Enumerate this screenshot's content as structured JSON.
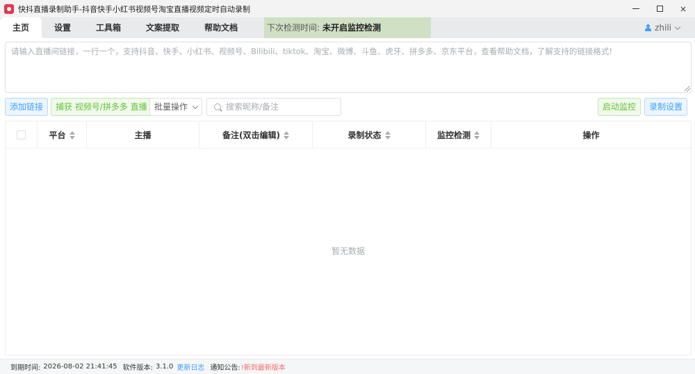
{
  "window": {
    "title": "快抖直播录制助手-抖音快手小红书视频号淘宝直播视频定时自动录制",
    "controls": {
      "minimize": "minimize-icon",
      "maximize": "maximize-icon",
      "close": "×"
    }
  },
  "tabs": [
    {
      "label": "主页",
      "active": true
    },
    {
      "label": "设置",
      "active": false
    },
    {
      "label": "工具箱",
      "active": false
    },
    {
      "label": "文案提取",
      "active": false
    },
    {
      "label": "帮助文档",
      "active": false
    }
  ],
  "monitor": {
    "label": "下次检测时间:",
    "value": "未开启监控检测"
  },
  "user": {
    "name": "zhili",
    "icon": "user-icon"
  },
  "link_input": {
    "placeholder": "请输入直播间链接，一行一个，支持抖音、快手、小红书、视频号、Bilibili、tiktok、淘宝、微博、斗鱼、虎牙、拼多多、京东平台，查看帮助文档，了解支持的链接格式!",
    "value": ""
  },
  "toolbar": {
    "add_link": "添加链接",
    "capture": "捕获 视频号/拼多多 直播",
    "batch": "批量操作",
    "search_placeholder": "搜索昵称/备注",
    "start_monitor": "启动监控",
    "record_settings": "录制设置"
  },
  "table": {
    "columns": [
      "平台",
      "主播",
      "备注(双击编辑)",
      "录制状态",
      "监控检测",
      "操作"
    ],
    "rows": [],
    "empty": "暂无数据"
  },
  "status": {
    "expire_label": "到期时间:",
    "expire_value": "2026-08-02 21:41:45",
    "version_label": "软件版本:",
    "version_value": "3.1.0",
    "changelog": "更新日志",
    "notice_label": "通知公告:",
    "notice_value": "!新到最新版本"
  },
  "colors": {
    "accent": "#409eff",
    "success": "#67c23a",
    "danger": "#f56c6c",
    "monitor_bg": "#cfe0c4"
  }
}
